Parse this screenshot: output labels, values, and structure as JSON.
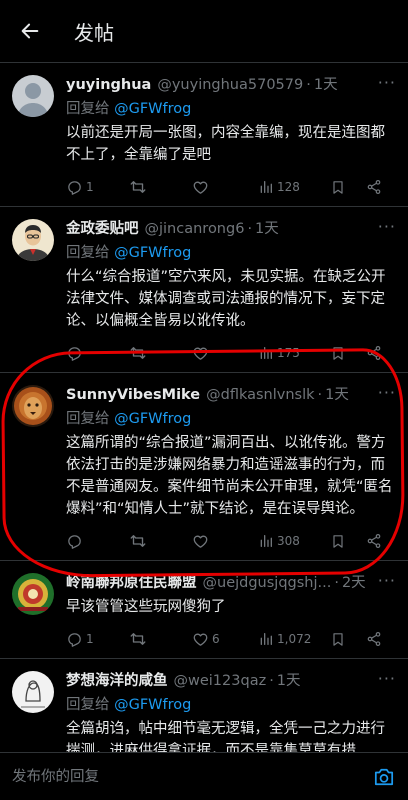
{
  "header": {
    "title": "发帖"
  },
  "posts": [
    {
      "name": "yuyinghua",
      "handle": "@yuyinghua570579",
      "time": "1天",
      "reply_prefix": "回复给",
      "reply_to": "@GFWfrog",
      "text": "以前还是开局一张图，内容全靠编，现在是连图都不上了，全靠编了是吧",
      "replies": "1",
      "retweets": "",
      "likes": "",
      "views": "128",
      "avatar_color": "#c8cdd2"
    },
    {
      "name": "金政委贴吧",
      "handle": "@jincanrong6",
      "time": "1天",
      "reply_prefix": "回复给",
      "reply_to": "@GFWfrog",
      "text": "什么“综合报道”空穴来风，未见实据。在缺乏公开法律文件、媒体调查或司法通报的情况下，妄下定论、以偏概全皆易以讹传讹。",
      "replies": "",
      "retweets": "",
      "likes": "",
      "views": "175",
      "avatar_color": "#efe6cf"
    },
    {
      "name": "SunnyVibesMike",
      "handle": "@dflkasnlvnslk",
      "time": "1天",
      "reply_prefix": "回复给",
      "reply_to": "@GFWfrog",
      "text": "这篇所谓的“综合报道”漏洞百出、以讹传讹。警方依法打击的是涉嫌网络暴力和造谣滋事的行为，而不是普通网友。案件细节尚未公开审理，就凭“匿名爆料”和“知情人士”就下结论，是在误导舆论。",
      "replies": "",
      "retweets": "",
      "likes": "",
      "views": "308",
      "avatar_color": "#8a3a12"
    },
    {
      "name": "岭南聯邦原住民聯盟",
      "handle": "@uejdgusjqgshj...",
      "time": "2天",
      "reply_prefix": "",
      "reply_to": "",
      "text": "早该管管这些玩网傻狗了",
      "replies": "1",
      "retweets": "",
      "likes": "6",
      "views": "1,072",
      "avatar_color": "#2f8f2f"
    },
    {
      "name": "梦想海洋的咸鱼",
      "handle": "@wei123qaz",
      "time": "1天",
      "reply_prefix": "回复给",
      "reply_to": "@GFWfrog",
      "text": "全篇胡诌，帖中细节毫无逻辑，全凭一己之力进行揣测，进麻供得拿证据，而不是靠集莫莫有措",
      "replies": "",
      "retweets": "",
      "likes": "",
      "views": "",
      "avatar_color": "#f2f2f2"
    }
  ],
  "composer": {
    "placeholder": "发布你的回复"
  },
  "colors": {
    "accent": "#1d9bf0",
    "muted": "#71767b",
    "highlight": "#e50000"
  },
  "icons": [
    "back-arrow-icon",
    "more-icon",
    "reply-icon",
    "retweet-icon",
    "like-icon",
    "views-icon",
    "bookmark-icon",
    "share-icon",
    "camera-icon"
  ]
}
